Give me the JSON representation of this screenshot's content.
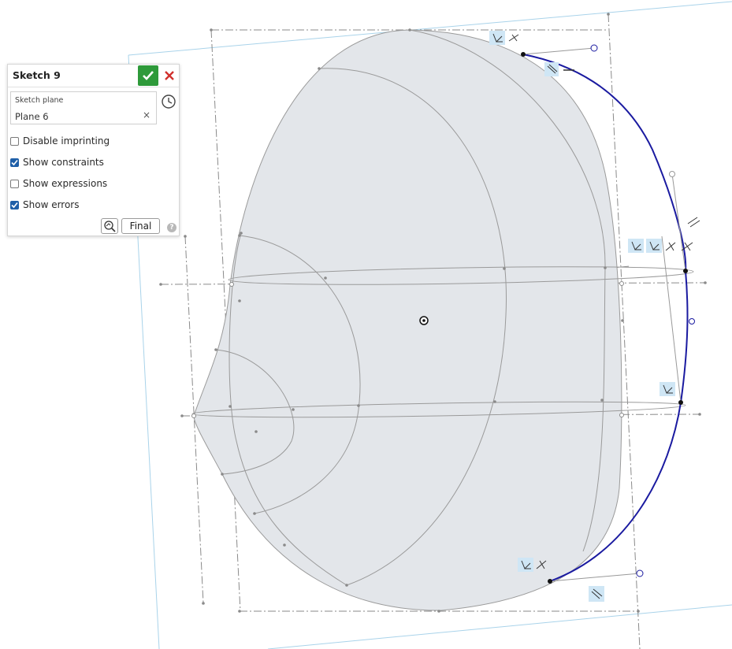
{
  "panel": {
    "title": "Sketch 9",
    "sketch_plane_label": "Sketch plane",
    "sketch_plane_value": "Plane 6",
    "clear_glyph": "×",
    "options": [
      {
        "label": "Disable imprinting",
        "checked": false
      },
      {
        "label": "Show constraints",
        "checked": true
      },
      {
        "label": "Show expressions",
        "checked": false
      },
      {
        "label": "Show errors",
        "checked": true
      }
    ],
    "final_label": "Final",
    "help_glyph": "?"
  },
  "icons": {
    "accept": "checkmark-icon",
    "cancel": "close-icon",
    "history": "clock-icon",
    "inspect": "sketch-inspect-icon",
    "help": "help-icon",
    "origin": "origin-icon"
  },
  "colors": {
    "accept": "#2e9a3a",
    "cancel": "#d0312d",
    "sketch_curve": "#1a1aa0",
    "model_fill": "#e3e6ea",
    "model_edge": "#9a9a9a",
    "plane": "#a9d3ea",
    "checkbox_on": "#1f5fa8",
    "constraint_bg": "#cfe6f5"
  }
}
